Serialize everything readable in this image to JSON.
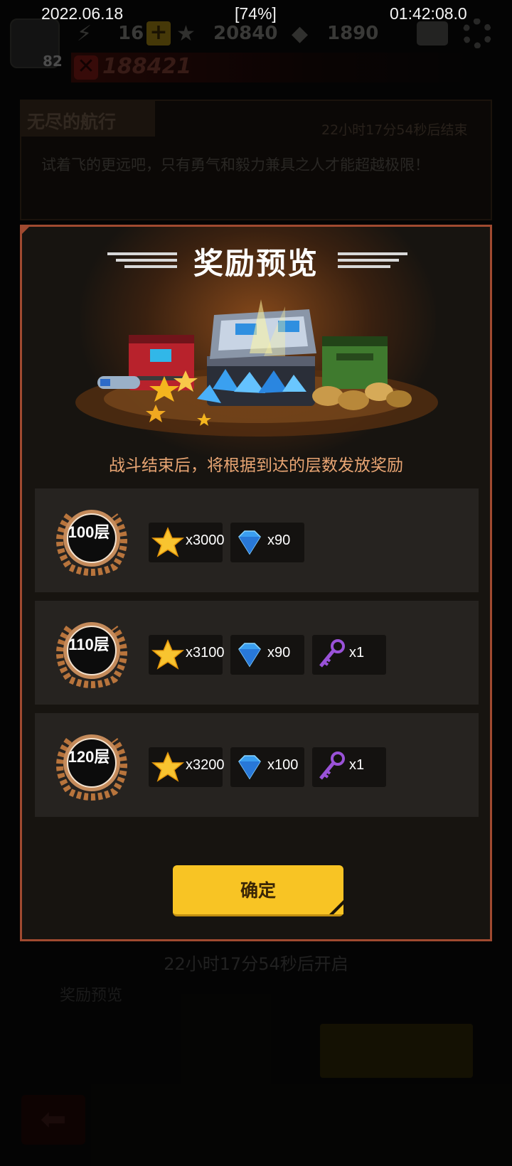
{
  "status_bar": {
    "date": "2022.06.18",
    "battery": "[74%]",
    "time": "01:42:08.0"
  },
  "top_bar": {
    "level": "82",
    "energy": "16",
    "stars": "20840",
    "gems": "1890",
    "power": "188421",
    "icons": [
      "lightning-icon",
      "plus-icon",
      "star-icon",
      "gem-icon",
      "mail-icon",
      "gear-icon",
      "power-icon"
    ]
  },
  "event": {
    "title": "无尽的航行",
    "timer": "22小时17分54秒后结束",
    "description": "试着飞的更远吧，只有勇气和毅力兼具之人才能超越极限！"
  },
  "modal": {
    "title": "奖励预览",
    "subtitle": "战斗结束后，将根据到达的层数发放奖励",
    "confirm_label": "确定",
    "rows": [
      {
        "floor": "100层",
        "rewards": [
          {
            "icon": "star-icon",
            "count": "x3000"
          },
          {
            "icon": "gem-icon",
            "count": "x90"
          }
        ]
      },
      {
        "floor": "110层",
        "rewards": [
          {
            "icon": "star-icon",
            "count": "x3100"
          },
          {
            "icon": "gem-icon",
            "count": "x90"
          },
          {
            "icon": "key-icon",
            "count": "x1"
          }
        ]
      },
      {
        "floor": "120层",
        "rewards": [
          {
            "icon": "star-icon",
            "count": "x3200"
          },
          {
            "icon": "gem-icon",
            "count": "x100"
          },
          {
            "icon": "key-icon",
            "count": "x1"
          }
        ]
      }
    ]
  },
  "bottom": {
    "timer": "22小时17分54秒后开启",
    "preview_label": "奖励预览"
  },
  "colors": {
    "modal_border": "#a04a30",
    "subtitle": "#e8a573",
    "confirm_button": "#f8c424",
    "badge_bronze": "#b8743c"
  }
}
